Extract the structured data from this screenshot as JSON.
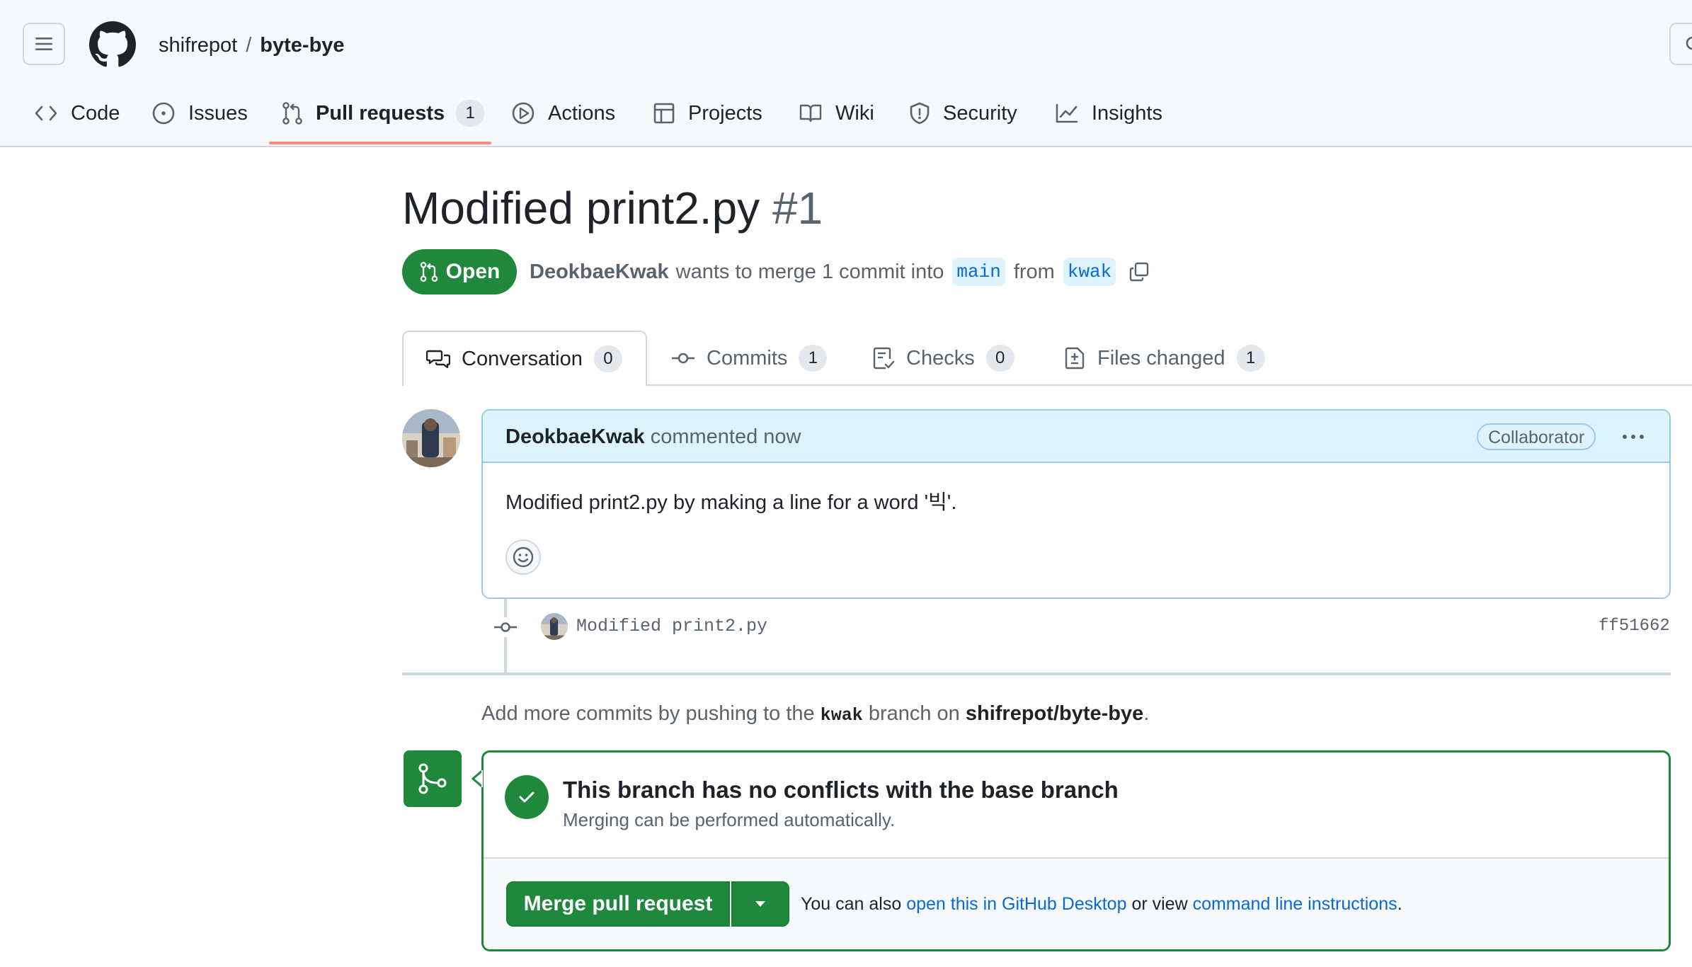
{
  "header": {
    "owner": "shifrepot",
    "separator": "/",
    "repo": "byte-bye"
  },
  "nav": {
    "items": [
      {
        "label": "Code",
        "icon": "code-icon"
      },
      {
        "label": "Issues",
        "icon": "issue-opened-icon"
      },
      {
        "label": "Pull requests",
        "icon": "git-pull-request-icon",
        "counter": "1",
        "active": true
      },
      {
        "label": "Actions",
        "icon": "play-icon"
      },
      {
        "label": "Projects",
        "icon": "table-icon"
      },
      {
        "label": "Wiki",
        "icon": "book-icon"
      },
      {
        "label": "Security",
        "icon": "shield-icon"
      },
      {
        "label": "Insights",
        "icon": "graph-icon"
      }
    ]
  },
  "pr": {
    "title": "Modified print2.py",
    "number": "#1",
    "state": "Open",
    "author": "DeokbaeKwak",
    "merge_text": "wants to merge 1 commit into",
    "base_branch": "main",
    "from_text": "from",
    "head_branch": "kwak"
  },
  "tabs": [
    {
      "label": "Conversation",
      "counter": "0",
      "icon": "comment-discussion-icon",
      "active": true
    },
    {
      "label": "Commits",
      "counter": "1",
      "icon": "git-commit-icon"
    },
    {
      "label": "Checks",
      "counter": "0",
      "icon": "checklist-icon"
    },
    {
      "label": "Files changed",
      "counter": "1",
      "icon": "file-diff-icon"
    }
  ],
  "comment": {
    "author": "DeokbaeKwak",
    "action": "commented now",
    "role_badge": "Collaborator",
    "body": "Modified print2.py by making a line for a word '빅'."
  },
  "commit": {
    "message": "Modified print2.py",
    "sha": "ff51662"
  },
  "push_note": {
    "prefix": "Add more commits by pushing to the",
    "branch": "kwak",
    "middle": "branch on",
    "repo": "shifrepot/byte-bye",
    "suffix": "."
  },
  "merge": {
    "title": "This branch has no conflicts with the base branch",
    "subtitle": "Merging can be performed automatically.",
    "button_label": "Merge pull request",
    "note_prefix": "You can also",
    "desktop_link": "open this in GitHub Desktop",
    "note_middle": "or view",
    "cli_link": "command line instructions",
    "note_suffix": "."
  },
  "colors": {
    "accent_green": "#1f883d",
    "link_blue": "#0969da",
    "nav_underline": "#fd8c73",
    "comment_header_bg": "#ddf4ff"
  }
}
